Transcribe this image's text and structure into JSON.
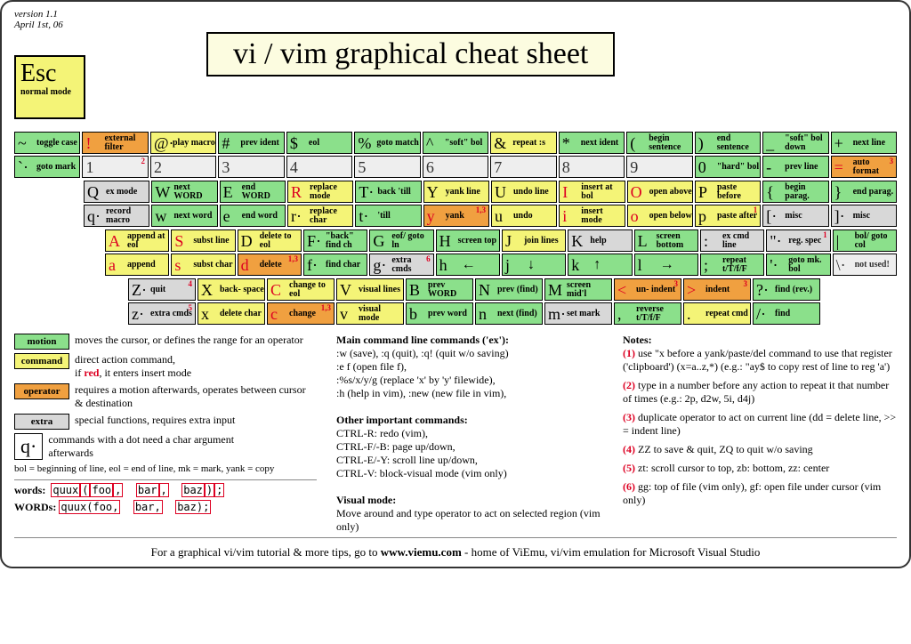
{
  "meta": {
    "version": "version 1.1",
    "date": "April 1st, 06"
  },
  "title": "vi / vim graphical cheat sheet",
  "esc": {
    "key": "Esc",
    "label": "normal mode"
  },
  "r1": [
    {
      "u": {
        "c": "m",
        "ch": "~",
        "lbl": "toggle case"
      },
      "l": {
        "c": "m",
        "ch": "`·",
        "lbl": "goto mark"
      }
    },
    {
      "u": {
        "c": "o",
        "ch": "!",
        "lbl": "external filter",
        "red": true
      },
      "l": {
        "c": "n",
        "ch": "1",
        "sup": "2"
      }
    },
    {
      "u": {
        "c": "c",
        "ch": "@·",
        "lbl": "play macro"
      },
      "l": {
        "c": "n",
        "ch": "2"
      }
    },
    {
      "u": {
        "c": "m",
        "ch": "#",
        "lbl": "prev ident"
      },
      "l": {
        "c": "n",
        "ch": "3"
      }
    },
    {
      "u": {
        "c": "m",
        "ch": "$",
        "lbl": "eol"
      },
      "l": {
        "c": "n",
        "ch": "4"
      }
    },
    {
      "u": {
        "c": "m",
        "ch": "%",
        "lbl": "goto match"
      },
      "l": {
        "c": "n",
        "ch": "5"
      }
    },
    {
      "u": {
        "c": "m",
        "ch": "^",
        "lbl": "\"soft\" bol"
      },
      "l": {
        "c": "n",
        "ch": "6"
      }
    },
    {
      "u": {
        "c": "c",
        "ch": "&",
        "lbl": "repeat :s"
      },
      "l": {
        "c": "n",
        "ch": "7"
      }
    },
    {
      "u": {
        "c": "m",
        "ch": "*",
        "lbl": "next ident"
      },
      "l": {
        "c": "n",
        "ch": "8"
      }
    },
    {
      "u": {
        "c": "m",
        "ch": "(",
        "lbl": "begin sentence"
      },
      "l": {
        "c": "n",
        "ch": "9"
      }
    },
    {
      "u": {
        "c": "m",
        "ch": ")",
        "lbl": "end sentence"
      },
      "l": {
        "c": "m",
        "ch": "0",
        "lbl": "\"hard\" bol"
      }
    },
    {
      "u": {
        "c": "m",
        "ch": "_",
        "lbl": "\"soft\" bol down"
      },
      "l": {
        "c": "m",
        "ch": "-",
        "lbl": "prev line"
      }
    },
    {
      "u": {
        "c": "m",
        "ch": "+",
        "lbl": "next line"
      },
      "l": {
        "c": "o",
        "ch": "=",
        "lbl": "auto format",
        "red": true,
        "sup": "3"
      }
    }
  ],
  "r2": [
    {
      "u": {
        "c": "x",
        "ch": "Q",
        "lbl": "ex mode"
      },
      "l": {
        "c": "x",
        "ch": "q·",
        "lbl": "record macro"
      }
    },
    {
      "u": {
        "c": "m",
        "ch": "W",
        "lbl": "next WORD"
      },
      "l": {
        "c": "m",
        "ch": "w",
        "lbl": "next word"
      }
    },
    {
      "u": {
        "c": "m",
        "ch": "E",
        "lbl": "end WORD"
      },
      "l": {
        "c": "m",
        "ch": "e",
        "lbl": "end word"
      }
    },
    {
      "u": {
        "c": "c",
        "ch": "R",
        "lbl": "replace mode",
        "red": true
      },
      "l": {
        "c": "c",
        "ch": "r·",
        "lbl": "replace char"
      }
    },
    {
      "u": {
        "c": "m",
        "ch": "T·",
        "lbl": "back 'till"
      },
      "l": {
        "c": "m",
        "ch": "t·",
        "lbl": "'till"
      }
    },
    {
      "u": {
        "c": "c",
        "ch": "Y",
        "lbl": "yank line"
      },
      "l": {
        "c": "o",
        "ch": "y",
        "lbl": "yank",
        "red": true,
        "sup": "1,3"
      }
    },
    {
      "u": {
        "c": "c",
        "ch": "U",
        "lbl": "undo line"
      },
      "l": {
        "c": "c",
        "ch": "u",
        "lbl": "undo"
      }
    },
    {
      "u": {
        "c": "c",
        "ch": "I",
        "lbl": "insert at bol",
        "red": true
      },
      "l": {
        "c": "c",
        "ch": "i",
        "lbl": "insert mode",
        "red": true
      }
    },
    {
      "u": {
        "c": "c",
        "ch": "O",
        "lbl": "open above",
        "red": true
      },
      "l": {
        "c": "c",
        "ch": "o",
        "lbl": "open below",
        "red": true
      }
    },
    {
      "u": {
        "c": "c",
        "ch": "P",
        "lbl": "paste before"
      },
      "l": {
        "c": "c",
        "ch": "p",
        "lbl": "paste after",
        "sup": "1"
      }
    },
    {
      "u": {
        "c": "m",
        "ch": "{",
        "lbl": "begin parag."
      },
      "l": {
        "c": "x",
        "ch": "[·",
        "lbl": "misc"
      }
    },
    {
      "u": {
        "c": "m",
        "ch": "}",
        "lbl": "end parag."
      },
      "l": {
        "c": "x",
        "ch": "]·",
        "lbl": "misc"
      }
    }
  ],
  "r3": [
    {
      "u": {
        "c": "c",
        "ch": "A",
        "lbl": "append at eol",
        "red": true
      },
      "l": {
        "c": "c",
        "ch": "a",
        "lbl": "append",
        "red": true
      }
    },
    {
      "u": {
        "c": "c",
        "ch": "S",
        "lbl": "subst line",
        "red": true
      },
      "l": {
        "c": "c",
        "ch": "s",
        "lbl": "subst char",
        "red": true
      }
    },
    {
      "u": {
        "c": "c",
        "ch": "D",
        "lbl": "delete to eol"
      },
      "l": {
        "c": "o",
        "ch": "d",
        "lbl": "delete",
        "red": true,
        "sup": "1,3"
      }
    },
    {
      "u": {
        "c": "m",
        "ch": "F·",
        "lbl": "\"back\" find ch"
      },
      "l": {
        "c": "m",
        "ch": "f·",
        "lbl": "find char"
      }
    },
    {
      "u": {
        "c": "m",
        "ch": "G",
        "lbl": "eof/ goto ln"
      },
      "l": {
        "c": "x",
        "ch": "g·",
        "lbl": "extra cmds",
        "sup": "6"
      }
    },
    {
      "u": {
        "c": "m",
        "ch": "H",
        "lbl": "screen top"
      },
      "l": {
        "c": "m",
        "ch": "h",
        "arrow": "←"
      }
    },
    {
      "u": {
        "c": "c",
        "ch": "J",
        "lbl": "join lines"
      },
      "l": {
        "c": "m",
        "ch": "j",
        "arrow": "↓"
      }
    },
    {
      "u": {
        "c": "x",
        "ch": "K",
        "lbl": "help"
      },
      "l": {
        "c": "m",
        "ch": "k",
        "arrow": "↑"
      }
    },
    {
      "u": {
        "c": "m",
        "ch": "L",
        "lbl": "screen bottom"
      },
      "l": {
        "c": "m",
        "ch": "l",
        "arrow": "→"
      }
    },
    {
      "u": {
        "c": "x",
        "ch": ":",
        "lbl": "ex cmd line"
      },
      "l": {
        "c": "m",
        "ch": ";",
        "lbl": "repeat t/T/f/F"
      }
    },
    {
      "u": {
        "c": "x",
        "ch": "\"·",
        "lbl": "reg. spec",
        "sup": "1"
      },
      "l": {
        "c": "m",
        "ch": "'·",
        "lbl": "goto mk. bol"
      }
    },
    {
      "u": {
        "c": "m",
        "ch": "|",
        "lbl": "bol/ goto col"
      },
      "l": {
        "c": "n",
        "ch": "\\·",
        "lbl": "not used!"
      }
    }
  ],
  "r4": [
    {
      "u": {
        "c": "x",
        "ch": "Z·",
        "lbl": "quit",
        "sup": "4"
      },
      "l": {
        "c": "x",
        "ch": "z·",
        "lbl": "extra cmds",
        "sup": "5"
      }
    },
    {
      "u": {
        "c": "c",
        "ch": "X",
        "lbl": "back- space"
      },
      "l": {
        "c": "c",
        "ch": "x",
        "lbl": "delete char"
      }
    },
    {
      "u": {
        "c": "c",
        "ch": "C",
        "lbl": "change to eol",
        "red": true
      },
      "l": {
        "c": "o",
        "ch": "c",
        "lbl": "change",
        "red": true,
        "sup": "1,3"
      }
    },
    {
      "u": {
        "c": "c",
        "ch": "V",
        "lbl": "visual lines"
      },
      "l": {
        "c": "c",
        "ch": "v",
        "lbl": "visual mode"
      }
    },
    {
      "u": {
        "c": "m",
        "ch": "B",
        "lbl": "prev WORD"
      },
      "l": {
        "c": "m",
        "ch": "b",
        "lbl": "prev word"
      }
    },
    {
      "u": {
        "c": "m",
        "ch": "N",
        "lbl": "prev (find)"
      },
      "l": {
        "c": "m",
        "ch": "n",
        "lbl": "next (find)"
      }
    },
    {
      "u": {
        "c": "m",
        "ch": "M",
        "lbl": "screen mid'l"
      },
      "l": {
        "c": "x",
        "ch": "m·",
        "lbl": "set mark"
      }
    },
    {
      "u": {
        "c": "o",
        "ch": "<",
        "lbl": "un- indent",
        "red": true,
        "sup": "3"
      },
      "l": {
        "c": "m",
        "ch": ",",
        "lbl": "reverse t/T/f/F"
      }
    },
    {
      "u": {
        "c": "o",
        "ch": ">",
        "lbl": "indent",
        "red": true,
        "sup": "3"
      },
      "l": {
        "c": "c",
        "ch": ".",
        "lbl": "repeat cmd"
      }
    },
    {
      "u": {
        "c": "m",
        "ch": "?·",
        "lbl": "find (rev.)"
      },
      "l": {
        "c": "m",
        "ch": "/·",
        "lbl": "find"
      }
    }
  ],
  "legend": {
    "motion": "moves the cursor, or defines the range for an operator",
    "command": "direct action command,",
    "command2": ", it enters insert mode",
    "operator": "requires a motion afterwards, operates between cursor  & destination",
    "extra": "special functions, requires extra input",
    "qdot": "commands with a dot need a char argument afterwards",
    "glossary": "bol = beginning of line, eol = end of line, mk = mark, yank = copy",
    "words_lbl": "words:",
    "words_val": "quux(foo,  bar,  baz);",
    "WORDS_lbl": "WORDs:",
    "WORDS_val": "quux(foo,  bar,  baz);"
  },
  "main_head": "Main command line commands ('ex'):",
  "main": ":w (save), :q (quit), :q! (quit w/o saving)\n:e f (open file f),\n:%s/x/y/g (replace 'x' by 'y' filewide),\n:h (help in vim), :new (new file in vim),",
  "other_head": "Other important commands:",
  "other": "CTRL-R: redo (vim),\nCTRL-F/-B: page up/down,\nCTRL-E/-Y: scroll line up/down,\nCTRL-V: block-visual mode (vim only)",
  "vis_head": "Visual mode:",
  "vis": "Move around and type operator to act on selected region (vim only)",
  "notes_head": "Notes:",
  "notes": [
    "use \"x before a yank/paste/del command to use that register ('clipboard') (x=a..z,*) (e.g.: \"ay$ to copy rest of line to reg 'a')",
    "type in a number before any action to repeat it that number of times (e.g.: 2p, d2w, 5i, d4j)",
    "duplicate operator to act on current line (dd = delete line, >> = indent line)",
    "ZZ to save & quit, ZQ to quit w/o saving",
    "zt: scroll cursor to top, zb: bottom, zz: center",
    "gg: top of file (vim only), gf: open file under cursor (vim only)"
  ],
  "footer1": "For a graphical vi/vim tutorial & more tips, go to   ",
  "footer2": "www.viemu.com",
  "footer3": "   - home of ViEmu, vi/vim emulation for Microsoft Visual Studio"
}
